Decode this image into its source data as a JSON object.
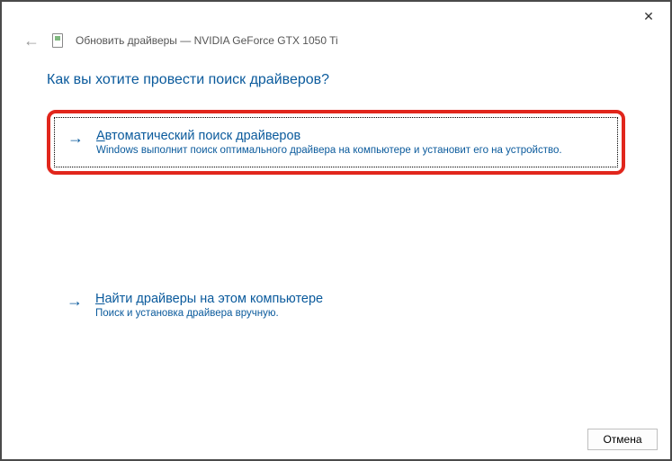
{
  "titlebar": {
    "close_glyph": "✕"
  },
  "header": {
    "back_glyph": "←",
    "title": "Обновить драйверы — NVIDIA GeForce GTX 1050 Ti"
  },
  "heading": "Как вы хотите провести поиск драйверов?",
  "options": {
    "auto": {
      "arrow": "→",
      "accel": "А",
      "title_rest": "втоматический поиск драйверов",
      "desc": "Windows выполнит поиск оптимального драйвера на компьютере и установит его на устройство."
    },
    "local": {
      "arrow": "→",
      "accel": "Н",
      "title_rest": "айти драйверы на этом компьютере",
      "desc": "Поиск и установка драйвера вручную."
    }
  },
  "footer": {
    "cancel_label": "Отмена"
  }
}
